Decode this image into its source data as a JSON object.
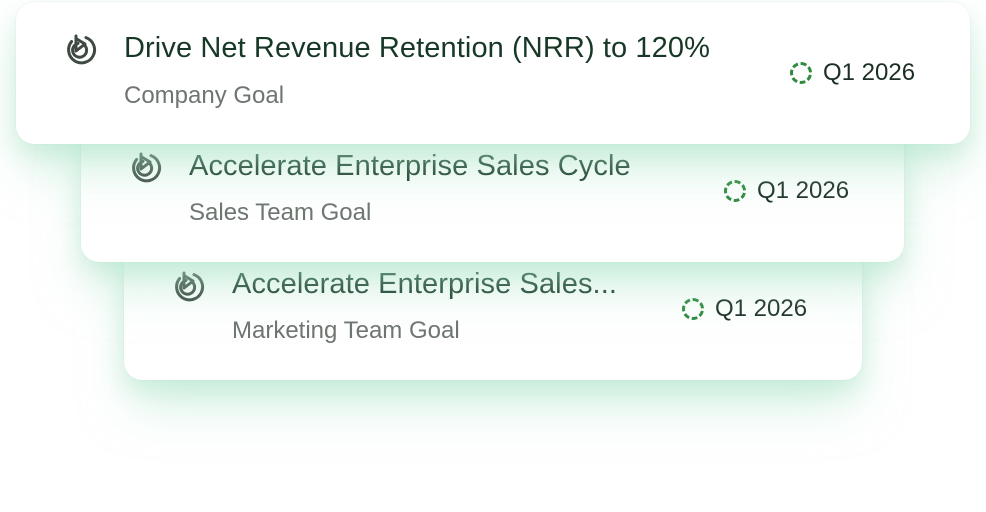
{
  "goals": [
    {
      "title": "Drive Net Revenue Retention (NRR) to 120%",
      "subtitle": "Company Goal",
      "quarter": "Q1 2026",
      "icon": "goal-target-icon"
    },
    {
      "title": "Accelerate Enterprise Sales Cycle",
      "subtitle": "Sales Team Goal",
      "quarter": "Q1 2026",
      "icon": "goal-target-icon"
    },
    {
      "title": "Accelerate Enterprise Sales...",
      "subtitle": "Marketing Team Goal",
      "quarter": "Q1 2026",
      "icon": "goal-target-icon"
    }
  ],
  "status_icon": "dashed-circle-icon",
  "colors": {
    "title": "#173826",
    "subtitle": "#6e7570",
    "icon": "#3e4a42",
    "status": "#2e8a3e",
    "glow": "#aae4c6"
  }
}
